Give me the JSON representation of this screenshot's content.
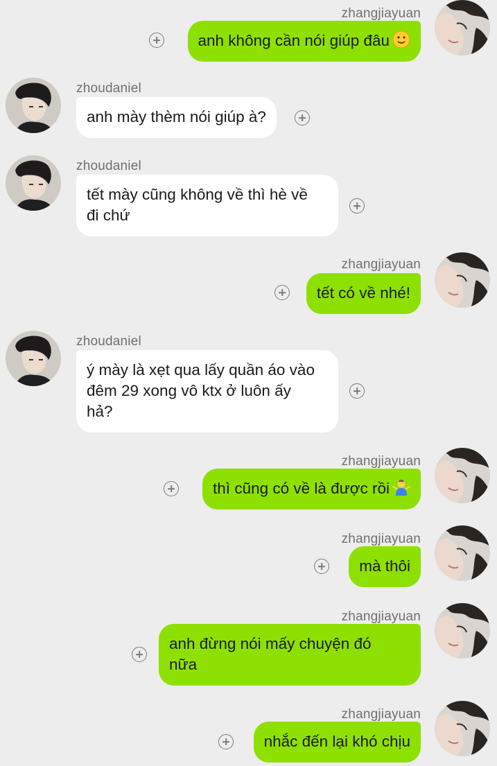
{
  "messages": [
    {
      "sender": "zhangjiayuan",
      "side": "right",
      "text": "anh không cần nói giúp đâu",
      "emoji": "slightly-smiling-face-icon"
    },
    {
      "sender": "zhoudaniel",
      "side": "left",
      "text": "anh mày thèm nói giúp à?"
    },
    {
      "sender": "zhoudaniel",
      "side": "left",
      "line1": "tết mày cũng không về thì hè về",
      "line2": "đi chứ"
    },
    {
      "sender": "zhangjiayuan",
      "side": "right",
      "text": "tết có về nhé!"
    },
    {
      "sender": "zhoudaniel",
      "side": "left",
      "line1": "ý mày là xẹt qua lấy quần áo vào",
      "line2": "đêm 29 xong vô ktx ở luôn ấy",
      "line3": "hả?"
    },
    {
      "sender": "zhangjiayuan",
      "side": "right",
      "text": "thì cũng có về là được rồi",
      "emoji": "person-shrugging-icon"
    },
    {
      "sender": "zhangjiayuan",
      "side": "right",
      "text": "mà thôi"
    },
    {
      "sender": "zhangjiayuan",
      "side": "right",
      "line1": "anh đừng nói mấy chuyện đó",
      "line2": "nữa"
    },
    {
      "sender": "zhangjiayuan",
      "side": "right",
      "text": "nhắc đến lại khó chịu"
    }
  ],
  "colors": {
    "background": "#ededed",
    "outgoing_bubble": "#8ee000",
    "incoming_bubble": "#ffffff",
    "sender_name": "#6f6f6f"
  }
}
